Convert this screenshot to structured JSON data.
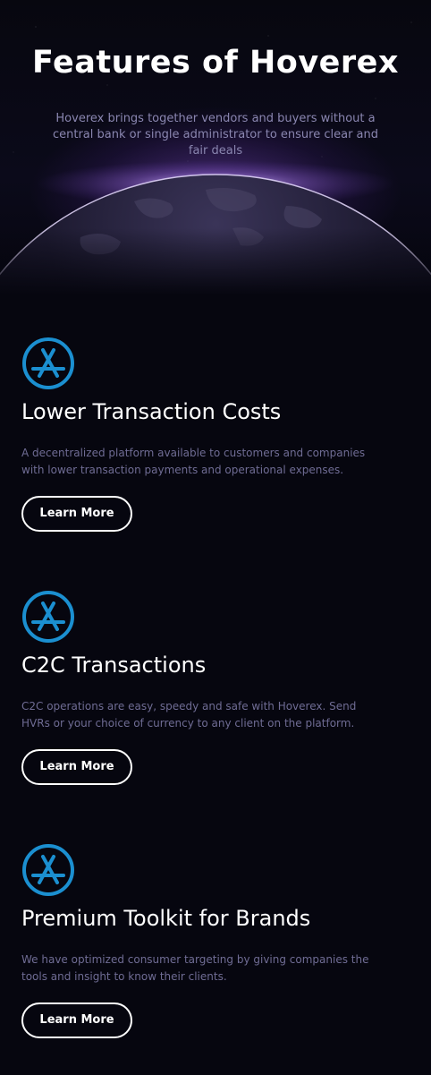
{
  "hero": {
    "title": "Features of Hoverex",
    "subtitle": "Hoverex brings together vendors and buyers without a central bank or single administrator to ensure clear and fair deals"
  },
  "colors": {
    "background": "#06060f",
    "accent": "#1b8fd0",
    "description_text": "#6f6c94",
    "subtitle_text": "#8a86b0",
    "glow": "#7a4cc4"
  },
  "features": [
    {
      "icon": "app-store-icon",
      "title": "Lower Transaction Costs",
      "description": "A decentralized platform available to customers and companies with lower transaction payments and operational expenses.",
      "button_label": "Learn More"
    },
    {
      "icon": "app-store-icon",
      "title": "C2C Transactions",
      "description": "C2C operations are easy, speedy and safe with Hoverex. Send HVRs or your choice of currency to any client on the platform.",
      "button_label": "Learn More"
    },
    {
      "icon": "app-store-icon",
      "title": "Premium Toolkit for Brands",
      "description": "We have optimized consumer targeting by giving companies the tools and insight to know their clients.",
      "button_label": "Learn More"
    }
  ]
}
